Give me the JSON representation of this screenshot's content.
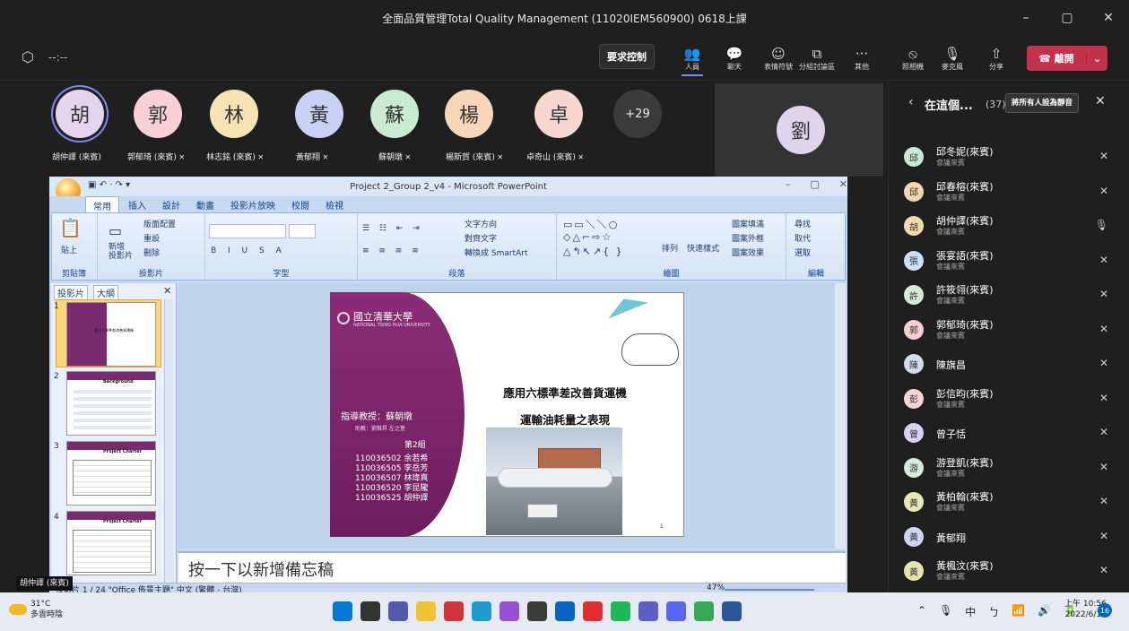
{
  "window": {
    "title": "全面品質管理Total Quality Management (11020IEM560900) 0618上課",
    "controls": [
      "–",
      "▢",
      "✕"
    ]
  },
  "toolbar": {
    "timer": "--:--",
    "request_control": "要求控制",
    "buttons": [
      {
        "icon": "people-icon",
        "glyph": "👥",
        "label": "人員"
      },
      {
        "icon": "chat-icon",
        "glyph": "💬",
        "label": "聊天"
      },
      {
        "icon": "reaction-icon",
        "glyph": "☺",
        "label": "表情符號"
      },
      {
        "icon": "breakout-icon",
        "glyph": "⧉",
        "label": "分組討論區"
      },
      {
        "icon": "more-icon",
        "glyph": "···",
        "label": "其他"
      },
      {
        "icon": "camera-off-icon",
        "glyph": "⦸",
        "label": "照相機"
      },
      {
        "icon": "mic-off-icon",
        "glyph": "🎙",
        "label": "麥克風"
      },
      {
        "icon": "share-icon",
        "glyph": "⇧",
        "label": "分享"
      }
    ],
    "leave_label": "離開"
  },
  "strip": {
    "participants": [
      {
        "initial": "胡",
        "name": "胡仲譯 (來賓)",
        "color": "#e4d4ee",
        "muted": false
      },
      {
        "initial": "郭",
        "name": "郭郁琦 (來賓)",
        "color": "#f6d0d4",
        "muted": true
      },
      {
        "initial": "林",
        "name": "林志銘 (來賓)",
        "color": "#f6e3b4",
        "muted": true
      },
      {
        "initial": "黃",
        "name": "黃郁翔",
        "color": "#c9d2f4",
        "muted": true
      },
      {
        "initial": "蘇",
        "name": "蘇朝墩",
        "color": "#c9ebd2",
        "muted": true
      },
      {
        "initial": "楊",
        "name": "楊斯賀 (來賓)",
        "color": "#f7d6b9",
        "muted": true
      },
      {
        "initial": "卓",
        "name": "卓奇山 (來賓)",
        "color": "#f6d7d0",
        "muted": true
      }
    ],
    "more": "+29",
    "spotlight_initial": "劉"
  },
  "powerpoint": {
    "title": "Project 2_Group 2_v4 - Microsoft PowerPoint",
    "qat": "▣ ↶ · ↷ ▾",
    "tabs": [
      "常用",
      "插入",
      "設計",
      "動畫",
      "投影片放映",
      "校閱",
      "檢視"
    ],
    "groups": [
      "剪貼簿",
      "投影片",
      "字型",
      "段落",
      "繪圖",
      "編輯"
    ],
    "ribbon_items": {
      "paste": "貼上",
      "new_slide": "新增\n投影片",
      "layout": "版面配置",
      "reset": "重設",
      "delete": "刪除",
      "text_direction": "文字方向",
      "align_text": "對齊文字",
      "smartart": "轉換成 SmartArt",
      "arrange": "排列",
      "quick_styles": "快速樣式",
      "shape_fill": "圖案填滿",
      "shape_outline": "圖案外框",
      "shape_effects": "圖案效果",
      "find": "尋找",
      "replace": "取代",
      "select": "選取"
    },
    "panel_tabs": [
      "投影片",
      "大綱"
    ],
    "thumbnails": [
      "1",
      "2",
      "3",
      "4"
    ],
    "thumb_titles": [
      "",
      "Background",
      "Project Charter",
      "Project Charter"
    ],
    "notes_placeholder": "按一下以新增備忘稿",
    "status": "投影片 1 / 24   \"Office 佈景主題\"   中文 (繁體 - 台灣)",
    "zoom": "47%"
  },
  "slide": {
    "university": "國立清華大學",
    "university_en": "NATIONAL TSING HUA UNIVERSITY",
    "title_line1": "應用六標準差改善貨運機",
    "title_line2": "運輸油耗量之表現",
    "advisor": "指導教授：蘇朝墩",
    "ta": "助教：劉惟昇  左之萱",
    "group": "第2組",
    "members": [
      "110036502 余若希",
      "110036505 李岳芳",
      "110036507 林瑋真",
      "110036520 李昆隴",
      "110036525 胡仲譯"
    ],
    "page": "1"
  },
  "people_panel": {
    "title": "在這個...",
    "count": "(37)",
    "mute_all": "將所有人設為靜音",
    "guest_label": "會議來賓",
    "list": [
      {
        "initial": "邱",
        "name": "邱冬妮(來賓)",
        "guest": true,
        "color": "#c8ead5",
        "mic": "muted"
      },
      {
        "initial": "邱",
        "name": "邱春榕(來賓)",
        "guest": true,
        "color": "#f6d4ad",
        "mic": "muted"
      },
      {
        "initial": "胡",
        "name": "胡仲譯(來賓)",
        "guest": true,
        "color": "#f2d9b0",
        "mic": "on"
      },
      {
        "initial": "張",
        "name": "張宴語(來賓)",
        "guest": true,
        "color": "#cfe0f6",
        "mic": "muted"
      },
      {
        "initial": "許",
        "name": "許筱翎(來賓)",
        "guest": true,
        "color": "#d2ecd8",
        "mic": "muted"
      },
      {
        "initial": "郭",
        "name": "郭郁琦(來賓)",
        "guest": true,
        "color": "#f6d0d4",
        "mic": "muted"
      },
      {
        "initial": "陳",
        "name": "陳旗昌",
        "guest": false,
        "color": "#d2dcef",
        "mic": "muted"
      },
      {
        "initial": "彭",
        "name": "彭信昀(來賓)",
        "guest": true,
        "color": "#f3d3d6",
        "mic": "muted"
      },
      {
        "initial": "曾",
        "name": "曾子恬",
        "guest": false,
        "color": "#d8d2ef",
        "mic": "muted"
      },
      {
        "initial": "游",
        "name": "游登凱(來賓)",
        "guest": true,
        "color": "#d4ecd9",
        "mic": "muted"
      },
      {
        "initial": "黃",
        "name": "黃柏翰(來賓)",
        "guest": true,
        "color": "#e8e8b4",
        "mic": "muted"
      },
      {
        "initial": "黃",
        "name": "黃郁翔",
        "guest": false,
        "color": "#cfd5f4",
        "mic": "muted"
      },
      {
        "initial": "黃",
        "name": "黃楓汶(來賓)",
        "guest": true,
        "color": "#e8e4b4",
        "mic": "muted"
      }
    ]
  },
  "viewer_chip": "胡仲譯 (來賓)",
  "taskbar": {
    "temp": "31°C",
    "weather": "多雲時陰",
    "tray_icons": [
      "⌃",
      "🎙",
      "中",
      "ㄅ",
      "📶",
      "🔊",
      "🔋"
    ],
    "time": "上午 10:56",
    "date": "2022/6/18",
    "notifications": "16",
    "apps": [
      {
        "name": "start-icon",
        "color": "#0078d4"
      },
      {
        "name": "search-icon",
        "color": "#333333"
      },
      {
        "name": "video-icon",
        "color": "#5558af"
      },
      {
        "name": "file-explorer-icon",
        "color": "#f2c230"
      },
      {
        "name": "app-red-icon",
        "color": "#d13438"
      },
      {
        "name": "edge-icon",
        "color": "#1d9bd1"
      },
      {
        "name": "vs-icon",
        "color": "#9b4fd6"
      },
      {
        "name": "terminal-icon",
        "color": "#3b3b3b"
      },
      {
        "name": "mail-icon",
        "color": "#0a64c4"
      },
      {
        "name": "media-icon",
        "color": "#e02e2e"
      },
      {
        "name": "spotify-icon",
        "color": "#1db954"
      },
      {
        "name": "teams-icon",
        "color": "#5b5fc7"
      },
      {
        "name": "discord-icon",
        "color": "#5865f2"
      },
      {
        "name": "chrome-icon",
        "color": "#34a853"
      },
      {
        "name": "word-icon",
        "color": "#2b579a"
      }
    ]
  }
}
